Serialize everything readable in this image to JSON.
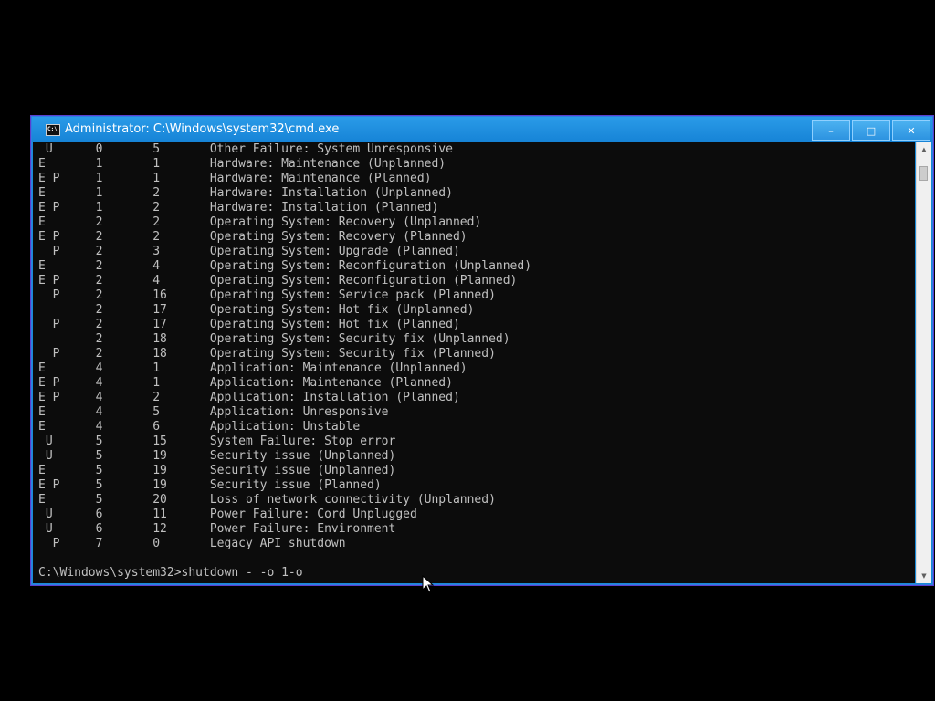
{
  "window": {
    "title": "Administrator: C:\\Windows\\system32\\cmd.exe",
    "icon_text": "C:\\",
    "buttons": {
      "minimize": "–",
      "maximize": "□",
      "close": "✕"
    }
  },
  "console": {
    "lines": [
      " U      0       5       Other Failure: System Unresponsive",
      "E       1       1       Hardware: Maintenance (Unplanned)",
      "E P     1       1       Hardware: Maintenance (Planned)",
      "E       1       2       Hardware: Installation (Unplanned)",
      "E P     1       2       Hardware: Installation (Planned)",
      "E       2       2       Operating System: Recovery (Unplanned)",
      "E P     2       2       Operating System: Recovery (Planned)",
      "  P     2       3       Operating System: Upgrade (Planned)",
      "E       2       4       Operating System: Reconfiguration (Unplanned)",
      "E P     2       4       Operating System: Reconfiguration (Planned)",
      "  P     2       16      Operating System: Service pack (Planned)",
      "        2       17      Operating System: Hot fix (Unplanned)",
      "  P     2       17      Operating System: Hot fix (Planned)",
      "        2       18      Operating System: Security fix (Unplanned)",
      "  P     2       18      Operating System: Security fix (Planned)",
      "E       4       1       Application: Maintenance (Unplanned)",
      "E P     4       1       Application: Maintenance (Planned)",
      "E P     4       2       Application: Installation (Planned)",
      "E       4       5       Application: Unresponsive",
      "E       4       6       Application: Unstable",
      " U      5       15      System Failure: Stop error",
      " U      5       19      Security issue (Unplanned)",
      "E       5       19      Security issue (Unplanned)",
      "E P     5       19      Security issue (Planned)",
      "E       5       20      Loss of network connectivity (Unplanned)",
      " U      6       11      Power Failure: Cord Unplugged",
      " U      6       12      Power Failure: Environment",
      "  P     7       0       Legacy API shutdown",
      "",
      "C:\\Windows\\system32>shutdown - -o 1-o"
    ]
  },
  "scrollbar": {
    "up_icon": "arrow-up-icon",
    "down_icon": "arrow-down-icon"
  },
  "colors": {
    "titlebar": "#1683d6",
    "console_bg": "#0c0c0c",
    "console_text": "#c0c0c0",
    "window_border": "#5a3fd0"
  }
}
